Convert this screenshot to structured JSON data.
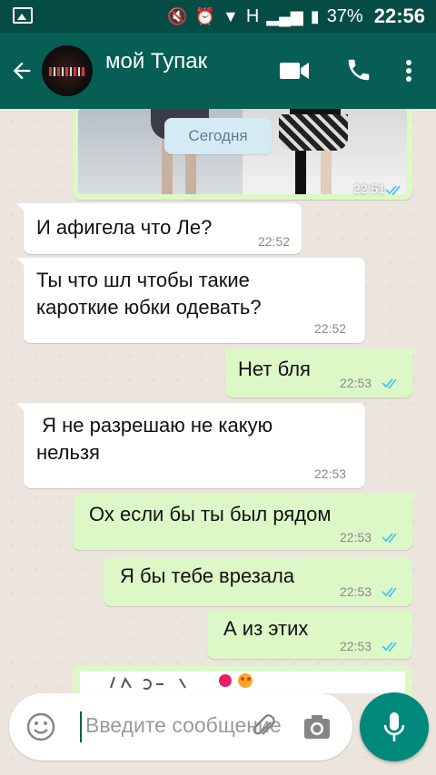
{
  "status_bar": {
    "battery": "37%",
    "time": "22:56",
    "network": "H"
  },
  "header": {
    "contact_name": "мой Тупак"
  },
  "chat": {
    "date_chip": "Сегодня",
    "image_message_time": "22:51",
    "messages": [
      {
        "direction": "in",
        "text": "И афигела что Ле?",
        "time": "22:52"
      },
      {
        "direction": "in",
        "text": "Ты что шл чтобы такие\nкароткие юбки одевать?",
        "time": "22:52"
      },
      {
        "direction": "out",
        "text": "Нет бля",
        "time": "22:53"
      },
      {
        "direction": "in",
        "text": " Я не разрешаю не какую\nнельзя",
        "time": "22:53"
      },
      {
        "direction": "out",
        "text": "Ох если бы ты был рядом",
        "time": "22:53"
      },
      {
        "direction": "out",
        "text": "Я бы тебе врезала",
        "time": "22:53"
      },
      {
        "direction": "out",
        "text": "А из этих",
        "time": "22:53"
      }
    ]
  },
  "composer": {
    "placeholder": "Введите сообщение"
  },
  "colors": {
    "header": "#075e54",
    "status_bar": "#054d44",
    "outgoing_bubble": "#dcf8c6",
    "fab": "#00897b",
    "read_ticks": "#4fc3f7"
  }
}
